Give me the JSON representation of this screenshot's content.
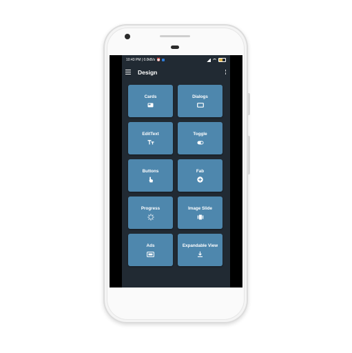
{
  "status_bar": {
    "time_speed": "10:43 PM | 0.0kB/s"
  },
  "toolbar": {
    "title": "Design",
    "menu_icon": "hamburger-menu-icon",
    "more_icon": "more-vert-icon"
  },
  "tiles": [
    {
      "label": "Cards",
      "icon": "card-icon"
    },
    {
      "label": "Dialogs",
      "icon": "dialog-window-icon"
    },
    {
      "label": "EditText",
      "icon": "text-format-icon"
    },
    {
      "label": "Toggle",
      "icon": "toggle-switch-icon"
    },
    {
      "label": "Buttons",
      "icon": "touch-hand-icon"
    },
    {
      "label": "Fab",
      "icon": "add-circle-icon"
    },
    {
      "label": "Progress",
      "icon": "loading-spinner-icon"
    },
    {
      "label": "Image Slide",
      "icon": "carousel-icon"
    },
    {
      "label": "Ads",
      "icon": "ad-icon"
    },
    {
      "label": "Expandable View",
      "icon": "download-expand-icon"
    }
  ],
  "colors": {
    "app_background": "#212a33",
    "tile": "#4e87ad",
    "text": "#ffffff"
  }
}
